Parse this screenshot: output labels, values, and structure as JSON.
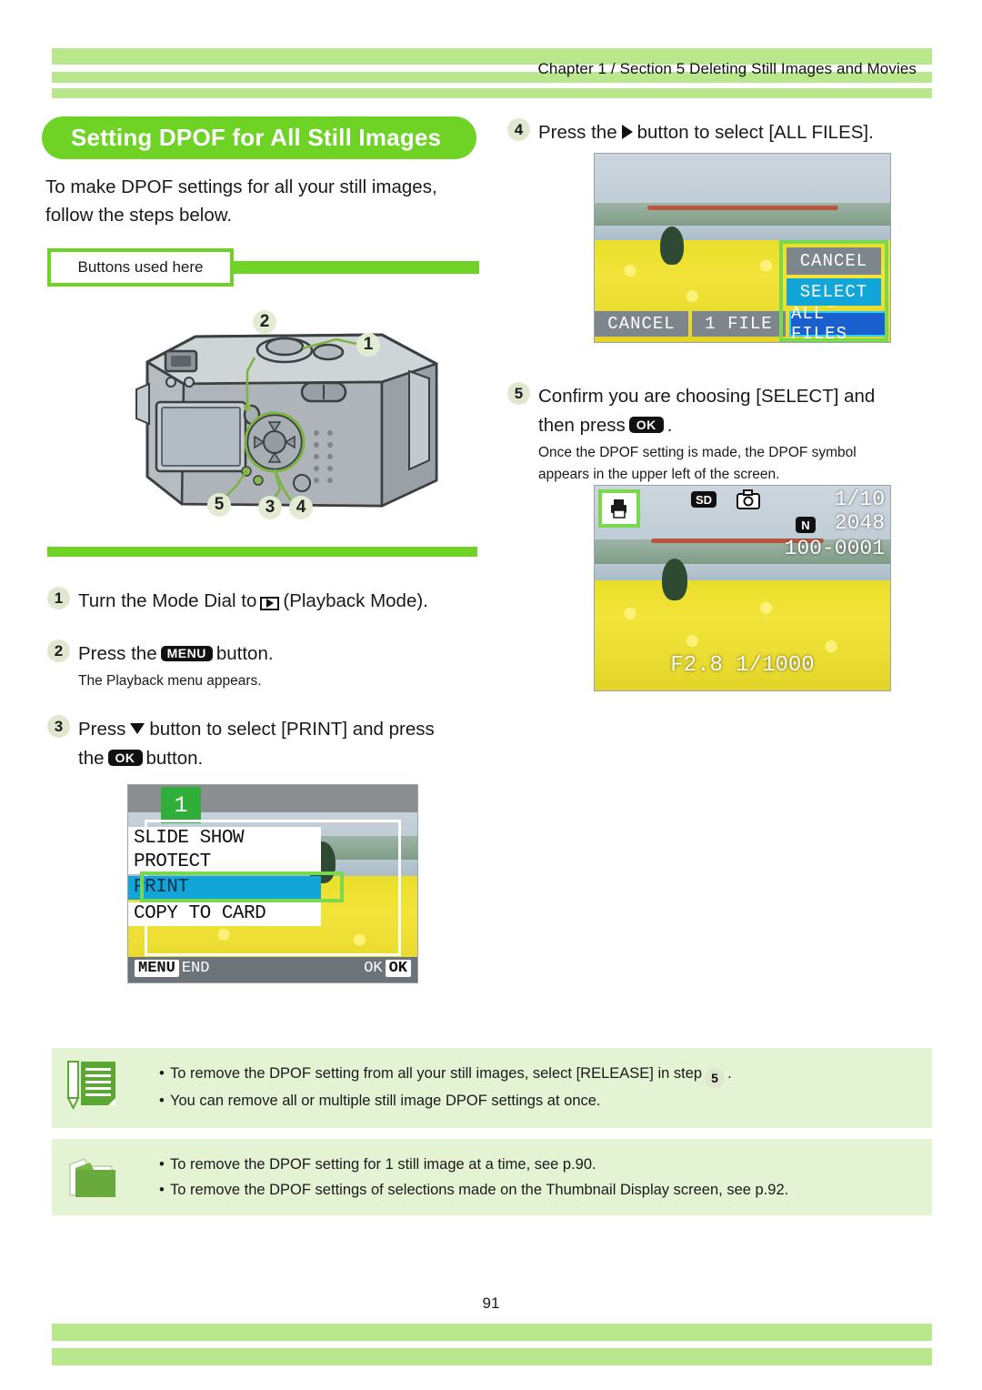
{
  "header": {
    "title": "Chapter  1 / Section 5  Deleting Still Images and Movies",
    "band_color": "#b9e88c"
  },
  "section_title": {
    "label": "Setting DPOF for All Still Images",
    "color": "#6ed325"
  },
  "intro": {
    "line1": "To make DPOF settings for all your still images,",
    "line2": "follow the steps below."
  },
  "buttons_used": {
    "label": "Buttons used here"
  },
  "camera_figure": {
    "callouts": [
      "2",
      "1",
      "5",
      "3",
      "4"
    ]
  },
  "steps": {
    "step1": {
      "number": "1",
      "text_before": "Turn the Mode Dial to",
      "icon": "playback-mode-icon",
      "text_after": "(Playback Mode)."
    },
    "step2": {
      "number": "2",
      "text_before": "Press the",
      "key": "MENU",
      "text_after": "button.",
      "sub": "The Playback menu appears."
    },
    "step3": {
      "number": "3",
      "text_before": "Press",
      "arrow": "down-arrow-icon",
      "text_mid": "button to select [PRINT] and press",
      "text_line2_before": "the",
      "key": "OK",
      "text_line2_after": "button."
    },
    "step4": {
      "number": "4",
      "text_before": "Press the",
      "arrow": "right-arrow-icon",
      "text_after": "button to select [ALL FILES]."
    },
    "step5": {
      "number": "5",
      "text_line1": "Confirm you are choosing [SELECT] and",
      "text_line2_before": "then press",
      "key": "OK",
      "text_line2_after": ".",
      "sub_line1": "Once the DPOF setting is made, the DPOF symbol",
      "sub_line2": "appears in the upper left of the screen."
    }
  },
  "lcd_menu": {
    "page_badge": "1",
    "items": [
      "SLIDE SHOW",
      "PROTECT",
      "PRINT",
      "COPY TO CARD"
    ],
    "selected_index": 2,
    "bottom_left_key": "MENU",
    "bottom_left_label": "END",
    "bottom_right_label": "OK",
    "bottom_right_key": "OK",
    "highlight_color": "#12a6d8",
    "selection_box_color": "#79d94e"
  },
  "lcd_all_files": {
    "bottom_buttons": [
      "CANCEL",
      "1 FILE",
      "ALL FILES"
    ],
    "popup_items": [
      "CANCEL",
      "SELECT"
    ],
    "popup_selected": "SELECT",
    "selected_bottom": "ALL FILES",
    "highlight_color": "#12a6d8",
    "selection_box_color": "#79d94e"
  },
  "lcd_final": {
    "card_badge": "SD",
    "camera_icon": "camera-icon",
    "frame_count": "1/10",
    "quality_badge": "N",
    "resolution": "2048",
    "file_number": "100-0001",
    "exposure": "F2.8 1/1000",
    "dpof_icon": "dpof-print-icon",
    "selection_box_color": "#79d94e"
  },
  "notes": {
    "note1": {
      "icon": "memo-pencil-icon",
      "bullets": [
        {
          "text_before": "To remove the DPOF setting from all your still images, select [RELEASE] in step",
          "badge": "5",
          "text_after": "."
        },
        {
          "text_before": "You can remove all or multiple still image DPOF settings at once.",
          "badge": "",
          "text_after": ""
        }
      ]
    },
    "note2": {
      "icon": "folder-icon",
      "bullets": [
        {
          "text": "To remove the DPOF setting for 1 still image at a time, see p.90."
        },
        {
          "text": "To remove the DPOF settings of selections made on the Thumbnail Display screen, see p.92."
        }
      ]
    },
    "box_color": "#e4f3d4"
  },
  "footer": {
    "page_number": "91"
  }
}
